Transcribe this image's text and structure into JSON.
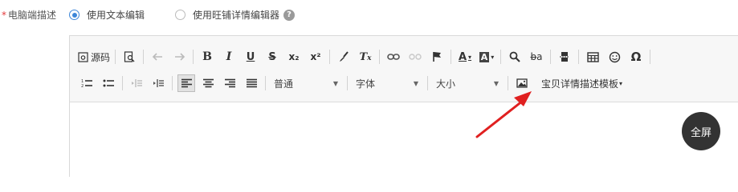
{
  "field": {
    "required_mark": "*",
    "label": "电脑端描述"
  },
  "mode": {
    "option_text": "使用文本编辑",
    "option_wangpu": "使用旺铺详情编辑器",
    "selected": "option_text",
    "help_icon": "?"
  },
  "toolbar": {
    "row1": {
      "source_label": "源码",
      "bold": "B",
      "italic": "I",
      "underline": "U",
      "strike": "S",
      "subscript": "x₂",
      "superscript": "x²",
      "remove_format": "T̲ₓ",
      "font_color": "A",
      "bg_color": "A",
      "replace": "b̶a",
      "special_char": "Ω"
    },
    "row2": {
      "format_value": "普通",
      "font_value": "字体",
      "size_value": "大小",
      "template_label": "宝贝详情描述模板"
    }
  },
  "fullscreen_label": "全屏",
  "annotation": {
    "arrow_color": "#e02020",
    "points_to": "insert-image-button"
  },
  "colors": {
    "accent": "#3d86d8",
    "required": "#e4393c",
    "toolbar_bg": "#f7f7f7",
    "fullscreen_bg": "#333333"
  }
}
